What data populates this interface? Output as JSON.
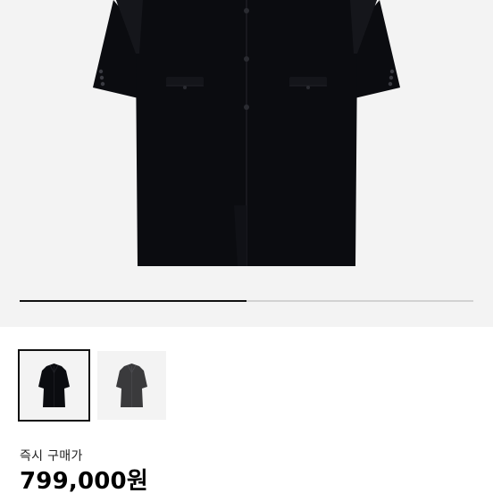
{
  "gallery": {
    "current_image_fraction": 0.5,
    "thumbnails": [
      {
        "name": "black-coat",
        "selected": true,
        "color": "#0b0c10"
      },
      {
        "name": "grey-coat",
        "selected": false,
        "color": "#3a3a3c"
      }
    ]
  },
  "product": {
    "purchase_type_label": "즉시 구매가",
    "price": "799,000원"
  },
  "colors": {
    "coat_black": "#0b0c10",
    "coat_grey": "#3a3a3c",
    "background": "#f3f3f3"
  }
}
